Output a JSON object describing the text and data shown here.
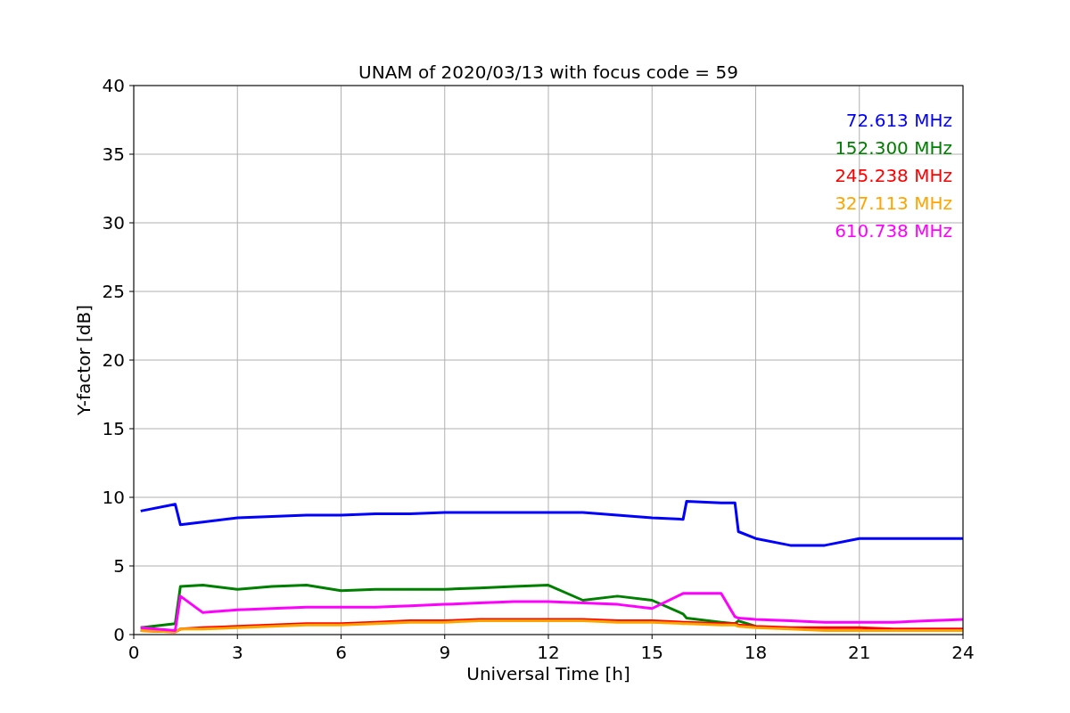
{
  "figure": {
    "chart_data": {
      "type": "line",
      "title": "UNAM of 2020/03/13 with focus code = 59",
      "xlabel": "Universal Time [h]",
      "ylabel": "Y-factor [dB]",
      "x": [
        0.2,
        1.2,
        1.35,
        2,
        3,
        4,
        5,
        6,
        7,
        8,
        9,
        10,
        11,
        12,
        13,
        14,
        15,
        15.9,
        16,
        17,
        17.4,
        17.5,
        18,
        19,
        20,
        21,
        22,
        23,
        24
      ],
      "series": [
        {
          "name": "72.613 MHz",
          "color": "#0000ff",
          "values": [
            9,
            9.5,
            8,
            8.2,
            8.5,
            8.6,
            8.7,
            8.7,
            8.8,
            8.8,
            8.9,
            8.9,
            8.9,
            8.9,
            8.9,
            8.7,
            8.5,
            8.4,
            9.7,
            9.6,
            9.6,
            7.5,
            7,
            6.5,
            6.5,
            7,
            7,
            7,
            7
          ]
        },
        {
          "name": "152.300 MHz",
          "color": "#008000",
          "values": [
            0.5,
            0.8,
            3.5,
            3.6,
            3.3,
            3.5,
            3.6,
            3.2,
            3.3,
            3.3,
            3.3,
            3.4,
            3.5,
            3.6,
            2.5,
            2.8,
            2.5,
            1.5,
            1.2,
            0.9,
            0.8,
            1,
            0.6,
            null,
            null,
            null,
            null,
            null,
            null
          ]
        },
        {
          "name": "245.238 MHz",
          "color": "#ff0000",
          "values": [
            0.3,
            0.2,
            0.4,
            0.5,
            0.6,
            0.7,
            0.8,
            0.8,
            0.9,
            1,
            1,
            1.1,
            1.1,
            1.1,
            1.1,
            1,
            1,
            0.9,
            0.9,
            0.8,
            0.8,
            0.7,
            0.6,
            0.5,
            0.5,
            0.5,
            0.4,
            0.4,
            0.4
          ]
        },
        {
          "name": "327.113 MHz",
          "color": "#ffa500",
          "values": [
            0.3,
            0.2,
            0.4,
            0.4,
            0.5,
            0.6,
            0.7,
            0.7,
            0.8,
            0.9,
            0.9,
            1,
            1,
            1,
            1,
            0.9,
            0.9,
            0.8,
            0.8,
            0.7,
            0.7,
            0.6,
            0.5,
            0.4,
            0.3,
            0.3,
            0.3,
            0.3,
            0.3
          ]
        },
        {
          "name": "610.738 MHz",
          "color": "#ff00ff",
          "values": [
            0.5,
            0.3,
            2.8,
            1.6,
            1.8,
            1.9,
            2,
            2,
            2,
            2.1,
            2.2,
            2.3,
            2.4,
            2.4,
            2.3,
            2.2,
            1.9,
            3,
            3,
            3,
            1.3,
            1.2,
            1.1,
            1,
            0.9,
            0.9,
            0.9,
            1,
            1.1
          ]
        }
      ],
      "grid": true,
      "xlim": [
        0,
        24
      ],
      "ylim": [
        0,
        40
      ],
      "xticks": [
        0,
        3,
        6,
        9,
        12,
        15,
        18,
        21,
        24
      ],
      "yticks": [
        0,
        5,
        10,
        15,
        20,
        25,
        30,
        35,
        40
      ]
    }
  }
}
